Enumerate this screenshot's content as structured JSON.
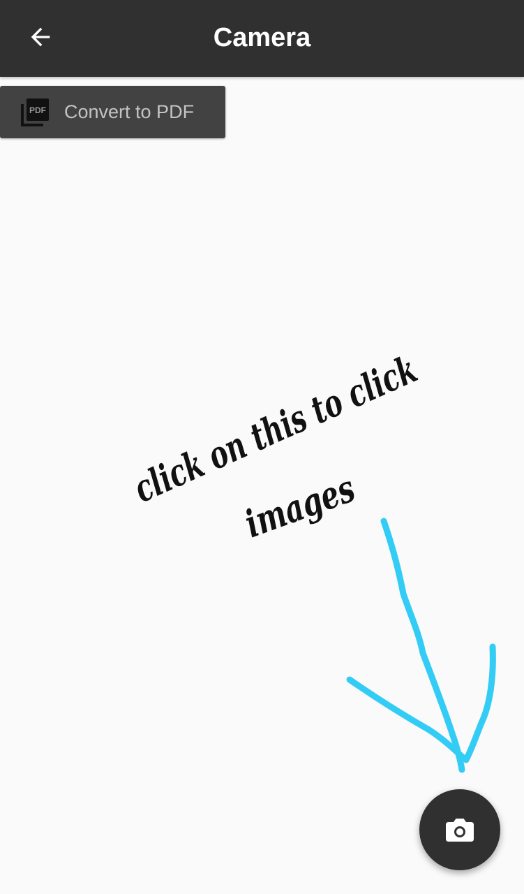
{
  "app_bar": {
    "title": "Camera",
    "back_icon": "arrow-back-icon",
    "background": "#303030"
  },
  "convert_button": {
    "label": "Convert to PDF",
    "icon": "pdf-icon",
    "icon_text": "PDF",
    "background": "#424242"
  },
  "annotation": {
    "line1": "click on this to click",
    "line2": "images",
    "arrow_color": "#33ccf5"
  },
  "fab": {
    "icon": "camera-icon",
    "background": "#303030"
  }
}
